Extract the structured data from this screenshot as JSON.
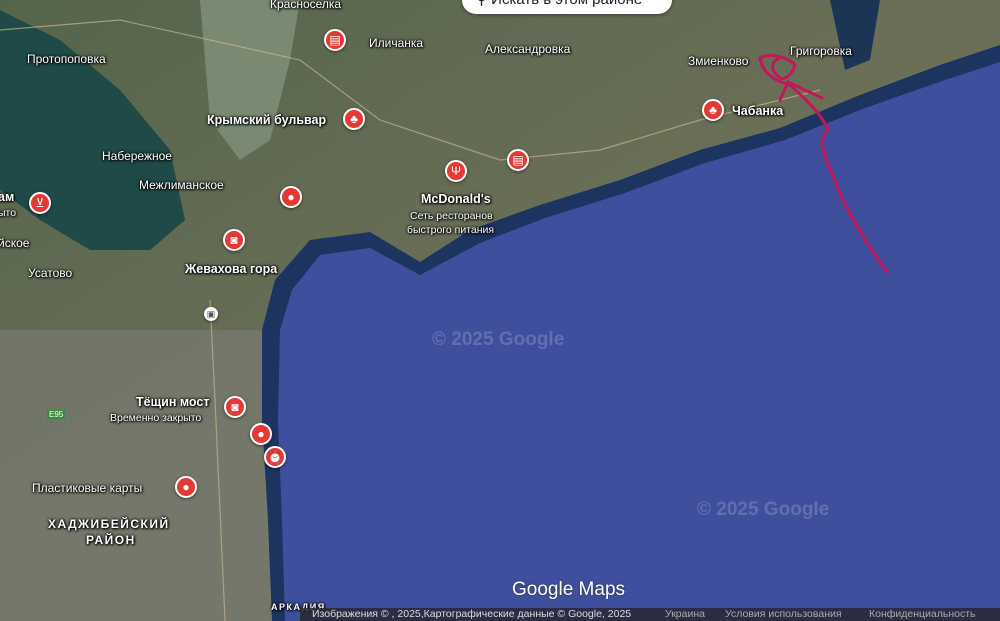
{
  "search_button": {
    "label": "Искать в этом районе",
    "icon": "search-icon"
  },
  "labels": {
    "krasnoselka": "Красноселка",
    "ilichanka": "Иличанка",
    "aleksandrovka": "Александровка",
    "protopopovka": "Протопоповка",
    "zmienkovo": "Змиенково",
    "grigorovka": "Григоровка",
    "chabanka": "Чабанка",
    "krymsky": "Крымский бульвар",
    "naberezhnoe": "Набережное",
    "mezhlimanskoe": "Межлиманское",
    "am": "ам",
    "yto": "ыто",
    "iyskoe": "йское",
    "usatovo": "Усатово",
    "mcdonalds": "McDonald's",
    "mcdonalds_sub1": "Сеть ресторанов",
    "mcdonalds_sub2": "быстрого питания",
    "zhevakhova": "Жевахова гора",
    "teshchin": "Тёщин мост",
    "teshchin_sub": "Временно закрыто",
    "plastic": "Пластиковые карты",
    "district1": "ХАДЖИБЕЙСКИЙ",
    "district2": "РАЙОН",
    "arkadia": "АРКАДИЯ",
    "e95": "E95"
  },
  "watermarks": [
    "© 2025 Google",
    "© 2025 Google"
  ],
  "logo": "Google Maps",
  "footer": {
    "imagery": "Изображения © , 2025,Картографические данные © Google, 2025",
    "country": "Украина",
    "terms": "Условия использования",
    "privacy": "Конфиденциальность"
  },
  "colors": {
    "sea": "#3f4f9e",
    "marker": "#e53935",
    "annotation": "#c2185b"
  }
}
